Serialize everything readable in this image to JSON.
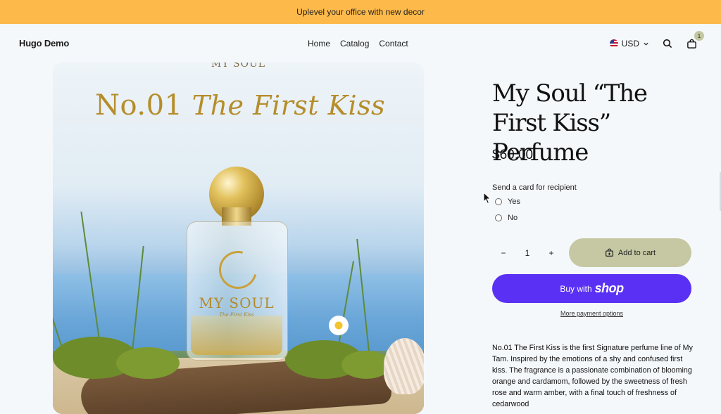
{
  "announcement": {
    "text": "Uplevel your office with new decor"
  },
  "header": {
    "logo": "Hugo Demo",
    "nav": [
      "Home",
      "Catalog",
      "Contact"
    ],
    "currency": "USD",
    "cart_count": "1"
  },
  "product_image": {
    "top_brand": "MY SOUL",
    "headline_number": "No.01",
    "headline_script": "The First Kiss",
    "bottle_brand": "MY SOUL",
    "bottle_sub": "The First Kiss"
  },
  "product": {
    "title": "My Soul “The First Kiss” Perfume",
    "price": "$60.00",
    "option_label": "Send a card for recipient",
    "options": [
      "Yes",
      "No"
    ],
    "quantity": "1",
    "add_to_cart": "Add to cart",
    "buy_with": "Buy with",
    "shop_word": "shop",
    "more_payment": "More payment options",
    "description": "No.01 The First Kiss is the first Signature perfume line of My Tam. Inspired by the emotions of a shy and confused first kiss. The fragrance is a passionate combination of blooming orange and cardamom, followed by the sweetness of fresh rose and warm amber, with a final touch of freshness of cedarwood"
  },
  "colors": {
    "announcement_bg": "#fdb94a",
    "shop_pay_purple": "#5a31f4",
    "add_to_cart_bg": "#c5c8a2"
  }
}
